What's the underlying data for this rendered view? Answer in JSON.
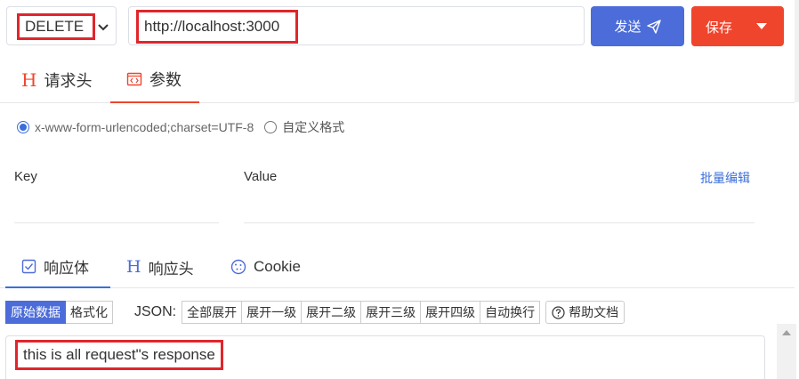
{
  "request": {
    "method": "DELETE",
    "url": "http://localhost:3000",
    "send_label": "发送",
    "save_label": "保存"
  },
  "request_tabs": [
    {
      "label": "请求头",
      "icon": "h-icon"
    },
    {
      "label": "参数",
      "icon": "code-icon"
    }
  ],
  "params": {
    "content_type_options": [
      "x-www-form-urlencoded;charset=UTF-8",
      "自定义格式"
    ],
    "selected": "x-www-form-urlencoded;charset=UTF-8",
    "key_header": "Key",
    "value_header": "Value",
    "bulk_edit_label": "批量编辑"
  },
  "response_tabs": [
    {
      "label": "响应体",
      "icon": "checkbox-icon"
    },
    {
      "label": "响应头",
      "icon": "h-icon"
    },
    {
      "label": "Cookie",
      "icon": "cookie-icon"
    }
  ],
  "toolbar": {
    "view_modes": [
      "原始数据",
      "格式化"
    ],
    "json_label": "JSON:",
    "expand_options": [
      "全部展开",
      "展开一级",
      "展开二级",
      "展开三级",
      "展开四级",
      "自动换行"
    ],
    "help_label": "帮助文档"
  },
  "response": {
    "body": "this is all request\"s response"
  },
  "colors": {
    "primary": "#4c6cd9",
    "danger": "#f0452d",
    "highlight": "#e0262c"
  }
}
